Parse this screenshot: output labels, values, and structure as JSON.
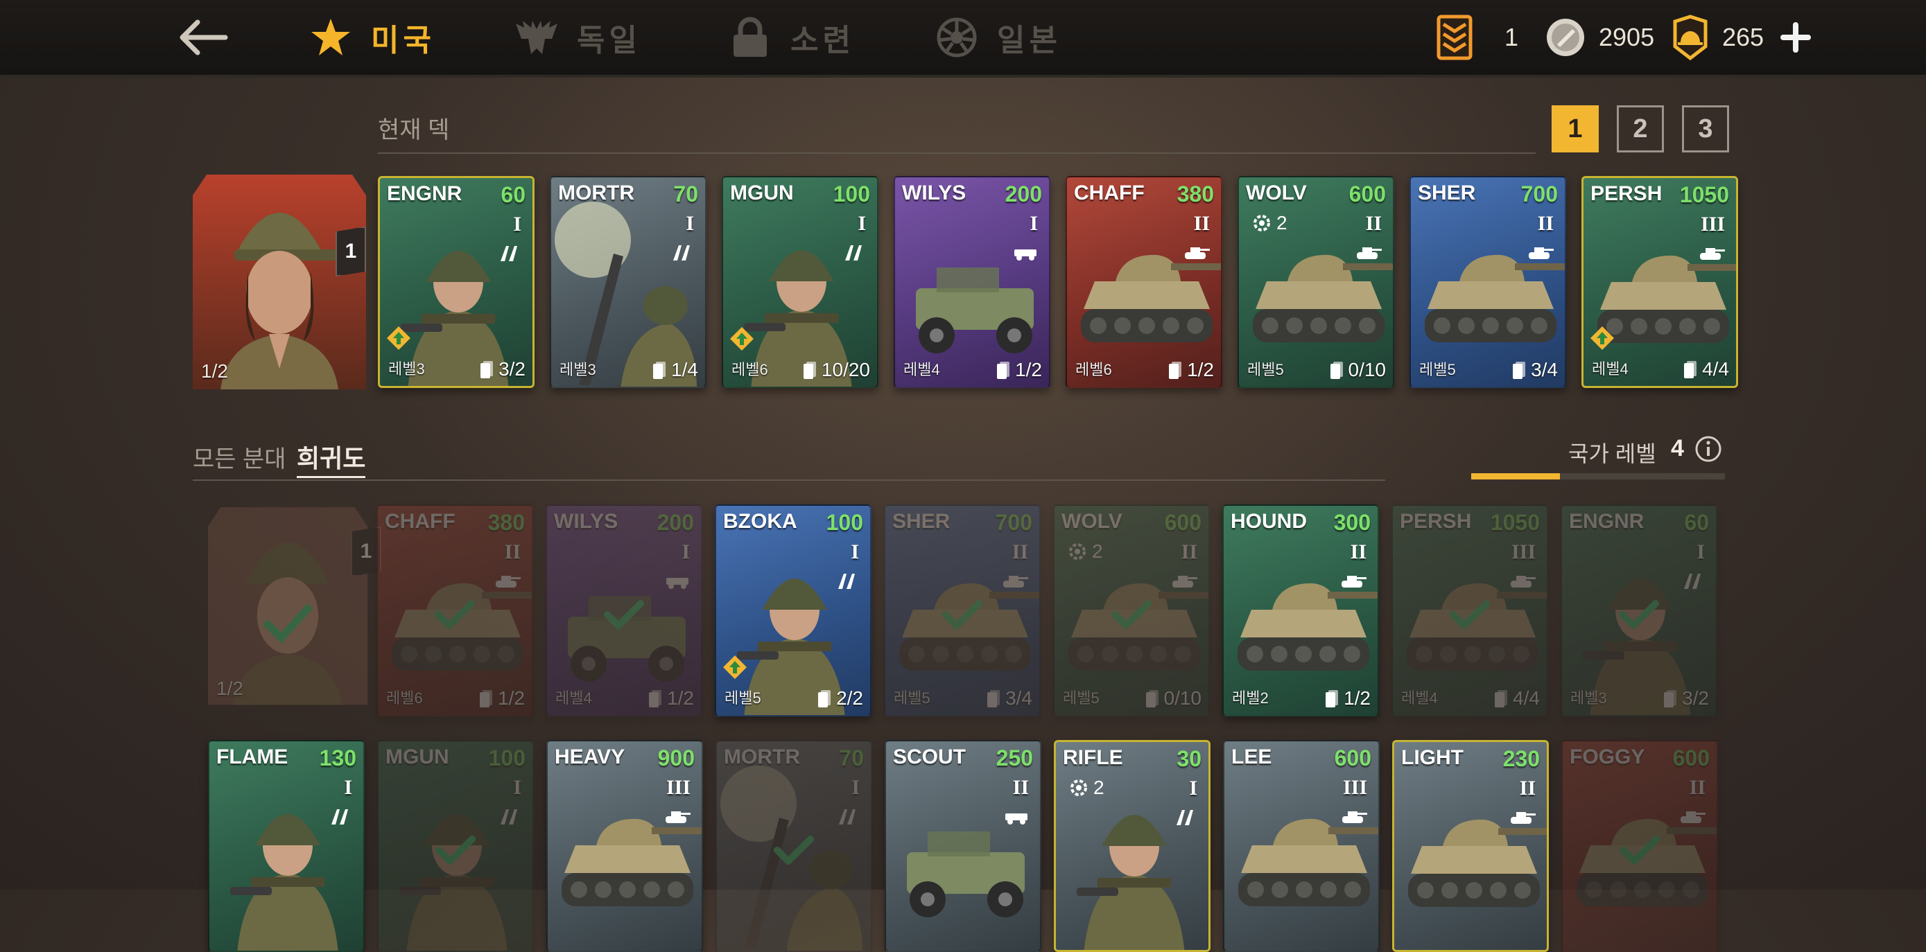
{
  "nav": {
    "tabs": [
      {
        "label": "미국",
        "icon": "star-icon",
        "active": true
      },
      {
        "label": "독일",
        "icon": "eagle-icon",
        "active": false
      },
      {
        "label": "소련",
        "icon": "lock-icon",
        "active": false
      },
      {
        "label": "일본",
        "icon": "rising-sun-icon",
        "active": false
      }
    ],
    "currencies": [
      {
        "icon": "ticket-icon",
        "value": "1"
      },
      {
        "icon": "silver-coin-icon",
        "value": "2905"
      },
      {
        "icon": "gold-helmet-icon",
        "value": "265"
      }
    ]
  },
  "deck": {
    "title": "현재 덱",
    "deck_tabs": [
      "1",
      "2",
      "3"
    ],
    "active_deck": "1",
    "commander": {
      "badge": "1",
      "slot": "1/2"
    },
    "cards": [
      {
        "name": "ENGNR",
        "cost": "60",
        "tier": "I",
        "level": "레벨3",
        "cards": "3/2",
        "bg": "green",
        "rare": true,
        "upgrade": true,
        "art": "soldier"
      },
      {
        "name": "MORTR",
        "cost": "70",
        "tier": "I",
        "level": "레벨3",
        "cards": "1/4",
        "bg": "gray",
        "rare": false,
        "upgrade": false,
        "art": "mortar"
      },
      {
        "name": "MGUN",
        "cost": "100",
        "tier": "I",
        "level": "레벨6",
        "cards": "10/20",
        "bg": "green",
        "rare": false,
        "upgrade": true,
        "art": "soldier"
      },
      {
        "name": "WILYS",
        "cost": "200",
        "tier": "I",
        "level": "레벨4",
        "cards": "1/2",
        "bg": "purple",
        "rare": false,
        "upgrade": false,
        "art": "jeep"
      },
      {
        "name": "CHAFF",
        "cost": "380",
        "tier": "II",
        "level": "레벨6",
        "cards": "1/2",
        "bg": "red",
        "rare": false,
        "upgrade": false,
        "art": "tank"
      },
      {
        "name": "WOLV",
        "cost": "600",
        "tier": "II",
        "level": "레벨5",
        "cards": "0/10",
        "bg": "green",
        "rare": false,
        "upgrade": false,
        "art": "tank",
        "count": "2"
      },
      {
        "name": "SHER",
        "cost": "700",
        "tier": "II",
        "level": "레벨5",
        "cards": "3/4",
        "bg": "blue",
        "rare": false,
        "upgrade": false,
        "art": "tank"
      },
      {
        "name": "PERSH",
        "cost": "1050",
        "tier": "III",
        "level": "레벨4",
        "cards": "4/4",
        "bg": "green",
        "rare": true,
        "upgrade": true,
        "art": "tank"
      }
    ]
  },
  "collection": {
    "all_label": "모든 분대",
    "sort_label": "희귀도",
    "nation_label": "국가 레벨",
    "nation_level": "4",
    "nation_progress": 0.35,
    "commander": {
      "badge": "1",
      "slot": "1/2"
    },
    "row1": [
      {
        "name": "CHAFF",
        "cost": "380",
        "tier": "II",
        "level": "레벨6",
        "cards": "1/2",
        "bg": "red",
        "dim": true,
        "art": "tank"
      },
      {
        "name": "WILYS",
        "cost": "200",
        "tier": "I",
        "level": "레벨4",
        "cards": "1/2",
        "bg": "purple",
        "dim": true,
        "art": "jeep"
      },
      {
        "name": "BZOKA",
        "cost": "100",
        "tier": "I",
        "level": "레벨5",
        "cards": "2/2",
        "bg": "blue",
        "dim": false,
        "upgrade": true,
        "art": "soldier"
      },
      {
        "name": "SHER",
        "cost": "700",
        "tier": "II",
        "level": "레벨5",
        "cards": "3/4",
        "bg": "blue",
        "dim": true,
        "art": "tank"
      },
      {
        "name": "WOLV",
        "cost": "600",
        "tier": "II",
        "level": "레벨5",
        "cards": "0/10",
        "bg": "green",
        "dim": true,
        "art": "tank",
        "count": "2"
      },
      {
        "name": "HOUND",
        "cost": "300",
        "tier": "II",
        "level": "레벨2",
        "cards": "1/2",
        "bg": "green",
        "dim": false,
        "art": "tank"
      },
      {
        "name": "PERSH",
        "cost": "1050",
        "tier": "III",
        "level": "레벨4",
        "cards": "4/4",
        "bg": "green",
        "dim": true,
        "art": "tank"
      },
      {
        "name": "ENGNR",
        "cost": "60",
        "tier": "I",
        "level": "레벨3",
        "cards": "3/2",
        "bg": "green",
        "dim": true,
        "art": "soldier"
      }
    ],
    "row2": [
      {
        "name": "FLAME",
        "cost": "130",
        "tier": "I",
        "bg": "green",
        "dim": false,
        "rare": false,
        "art": "soldier"
      },
      {
        "name": "MGUN",
        "cost": "100",
        "tier": "I",
        "bg": "green",
        "dim": true,
        "rare": false,
        "art": "soldier"
      },
      {
        "name": "HEAVY",
        "cost": "900",
        "tier": "III",
        "bg": "gray",
        "dim": false,
        "rare": false,
        "art": "tank"
      },
      {
        "name": "MORTR",
        "cost": "70",
        "tier": "I",
        "bg": "gray",
        "dim": true,
        "rare": false,
        "art": "mortar"
      },
      {
        "name": "SCOUT",
        "cost": "250",
        "tier": "II",
        "bg": "gray",
        "dim": false,
        "rare": false,
        "art": "jeep"
      },
      {
        "name": "RIFLE",
        "cost": "30",
        "tier": "I",
        "bg": "gray",
        "dim": false,
        "rare": true,
        "art": "soldier",
        "count": "2"
      },
      {
        "name": "LEE",
        "cost": "600",
        "tier": "III",
        "bg": "gray",
        "dim": false,
        "rare": false,
        "art": "tank"
      },
      {
        "name": "LIGHT",
        "cost": "230",
        "tier": "II",
        "bg": "gray",
        "dim": false,
        "rare": true,
        "art": "tank"
      },
      {
        "name": "FOGGY",
        "cost": "600",
        "tier": "II",
        "bg": "red",
        "dim": true,
        "rare": false,
        "art": "tank"
      }
    ]
  },
  "colors": {
    "accent": "#f2b631",
    "cost_green": "#7ee06a",
    "rare_border": "#c7b431"
  }
}
